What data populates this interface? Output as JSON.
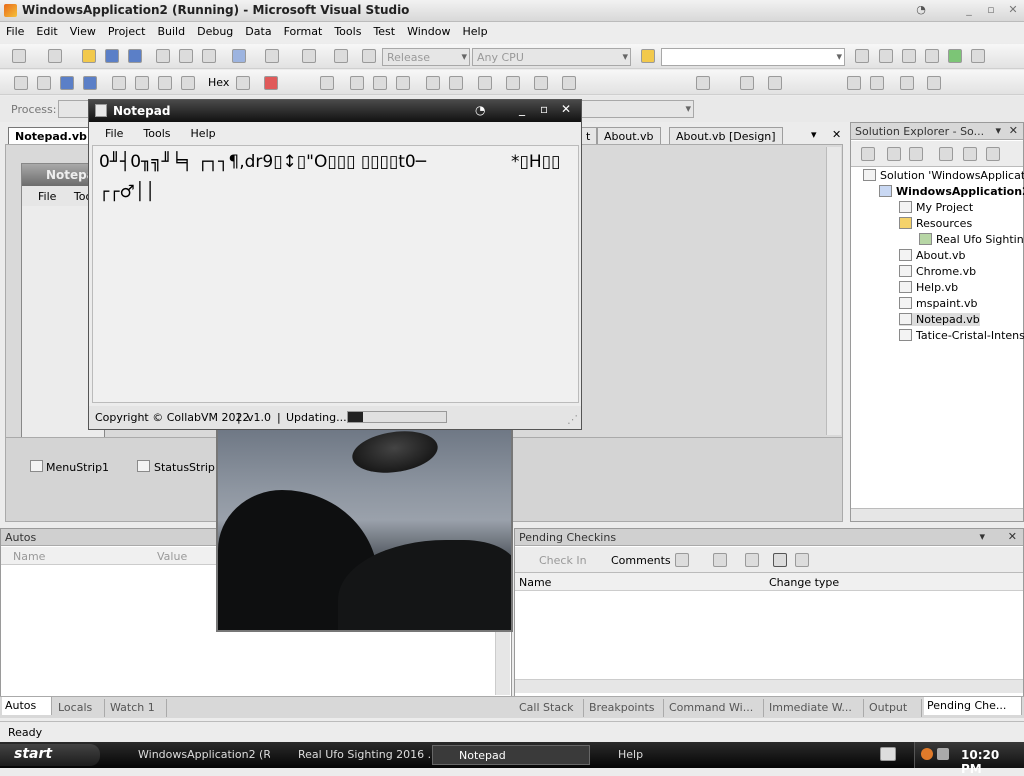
{
  "app": {
    "title": "WindowsApplication2 (Running) - Microsoft Visual Studio"
  },
  "menus": [
    "File",
    "Edit",
    "View",
    "Project",
    "Build",
    "Debug",
    "Data",
    "Format",
    "Tools",
    "Test",
    "Window",
    "Help"
  ],
  "toolbar": {
    "config": "Release",
    "platform": "Any CPU",
    "hex_label": "Hex",
    "process_label": "Process:"
  },
  "tabs": [
    {
      "label": "Notepad.vb ["
    },
    {
      "label": "t"
    },
    {
      "label": "About.vb"
    },
    {
      "label": "About.vb [Design]"
    }
  ],
  "designer": {
    "form_title": "Notepad",
    "menu_file": "File",
    "menu_tools": "Too",
    "components": [
      "MenuStrip1",
      "StatusStrip1"
    ]
  },
  "notepad": {
    "title": "Notepad",
    "menus": [
      "File",
      "Tools",
      "Help"
    ],
    "line1": "0╜┤0╖╗╜╘╕ ┌┐┐¶,dr9▯↕▯\"O▯▯▯ ▯▯▯▯t0─",
    "line1b": "*▯H▯▯",
    "line2": "┌┌♂││",
    "status_copyright": "Copyright © CollabVM 2022",
    "status_version": "v1.0",
    "status_updating": "Updating...",
    "progress": 0.15
  },
  "solution_explorer": {
    "title": "Solution Explorer - So...",
    "items": [
      "Solution 'WindowsApplication2",
      "WindowsApplication2",
      "My Project",
      "Resources",
      "Real Ufo Sighting",
      "About.vb",
      "Chrome.vb",
      "Help.vb",
      "mspaint.vb",
      "Notepad.vb",
      "Tatice-Cristal-Intense"
    ]
  },
  "autos": {
    "title": "Autos",
    "col_name": "Name",
    "col_value": "Value",
    "tabs": [
      "Autos",
      "Locals",
      "Watch 1"
    ]
  },
  "pending": {
    "title": "Pending Checkins",
    "check_in": "Check In",
    "comments": "Comments",
    "col_name": "Name",
    "col_change": "Change type",
    "tabs": [
      "Call Stack",
      "Breakpoints",
      "Command Wi...",
      "Immediate W...",
      "Output",
      "Pending Che..."
    ]
  },
  "status": {
    "text": "Ready"
  },
  "taskbar": {
    "start": "start",
    "items": [
      "WindowsApplication2 (R...",
      "Real Ufo Sighting 2016 ...",
      "Notepad",
      "Help"
    ],
    "clock": "10:20 PM"
  }
}
